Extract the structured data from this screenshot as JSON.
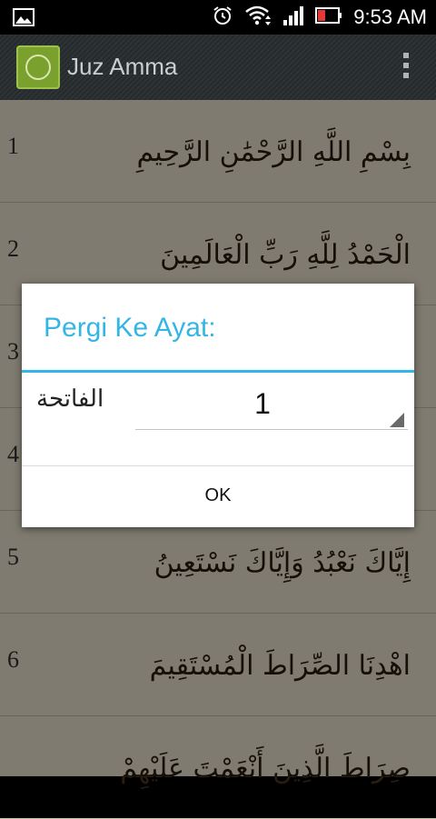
{
  "status_bar": {
    "time": "9:53 AM",
    "icons": [
      "image-icon",
      "alarm-icon",
      "wifi-icon",
      "signal-icon",
      "battery-icon"
    ]
  },
  "action_bar": {
    "title": "Juz Amma",
    "icons": [
      "app-icon",
      "overflow-menu-icon"
    ]
  },
  "list": {
    "items": [
      {
        "number": "1",
        "text": "بِسْمِ اللَّهِ الرَّحْمَٰنِ الرَّحِيمِ"
      },
      {
        "number": "2",
        "text": "الْحَمْدُ لِلَّهِ رَبِّ الْعَالَمِينَ"
      },
      {
        "number": "3",
        "text": ""
      },
      {
        "number": "4",
        "text": ""
      },
      {
        "number": "5",
        "text": "إِيَّاكَ نَعْبُدُ وَإِيَّاكَ نَسْتَعِينُ"
      },
      {
        "number": "6",
        "text": "اهْدِنَا الصِّرَاطَ الْمُسْتَقِيمَ"
      },
      {
        "number": "",
        "text": "صِرَاطَ الَّذِينَ أَنْعَمْتَ عَلَيْهِمْ"
      }
    ]
  },
  "dialog": {
    "title": "Pergi Ke Ayat:",
    "surah_name": "الفاتحة",
    "ayat_value": "1",
    "ok_label": "OK"
  },
  "colors": {
    "accent": "#33b5e5",
    "list_background": "#f3ecd6",
    "action_bar": "#2e3436"
  }
}
